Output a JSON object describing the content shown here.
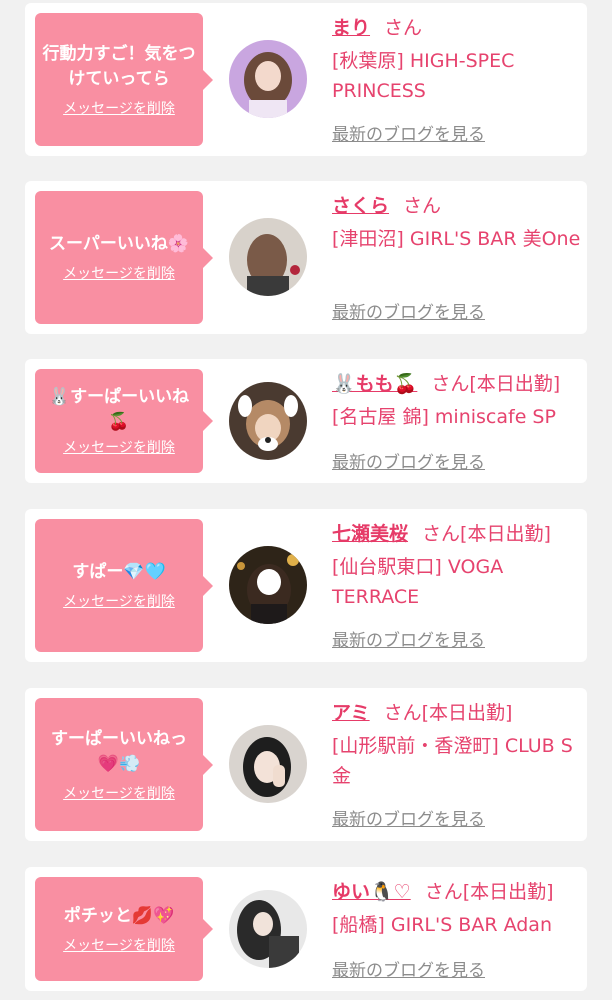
{
  "cards": [
    {
      "bubble_text": "行動力すご！気をつけていってら",
      "delete_label": "メッセージを削除",
      "name": "まり",
      "honorific": "さん",
      "status": "",
      "shop": "[秋葉原] HIGH-SPEC PRINCESS",
      "blog_label": "最新のブログを見る"
    },
    {
      "bubble_text": "スーパーいいね🌸",
      "delete_label": "メッセージを削除",
      "name": "さくら",
      "honorific": "さん",
      "status": "",
      "shop": "[津田沼] GIRL'S BAR 美One",
      "blog_label": "最新のブログを見る"
    },
    {
      "bubble_text": "🐰すーぱーいいね🍒",
      "delete_label": "メッセージを削除",
      "name": "🐰もも🍒",
      "honorific": "さん",
      "status": "[本日出勤]",
      "shop": "[名古屋 錦] miniscafe SP",
      "blog_label": "最新のブログを見る"
    },
    {
      "bubble_text": "すぱー💎🩵",
      "delete_label": "メッセージを削除",
      "name": "七瀬美桜",
      "honorific": "さん",
      "status": "[本日出勤]",
      "shop": "[仙台駅東口] VOGA TERRACE",
      "blog_label": "最新のブログを見る"
    },
    {
      "bubble_text": "すーぱーいいねっ💗💨",
      "delete_label": "メッセージを削除",
      "name": "アミ",
      "honorific": "さん",
      "status": "[本日出勤]",
      "shop": "[山形駅前・香澄町] CLUB S金",
      "blog_label": "最新のブログを見る"
    },
    {
      "bubble_text": "ポチッと💋💖",
      "delete_label": "メッセージを削除",
      "name": "ゆい🐧♡",
      "honorific": "さん",
      "status": "[本日出勤]",
      "shop": "[船橋] GIRL'S BAR Adan",
      "blog_label": "最新のブログを見る"
    }
  ],
  "colors": {
    "page_bg": "#f1f1f1",
    "card_bg": "#ffffff",
    "bubble_bg": "#f98fa2",
    "name_pink": "#e63b68",
    "text_pink": "#e6436e",
    "blog_gray": "#8c8c8c"
  }
}
